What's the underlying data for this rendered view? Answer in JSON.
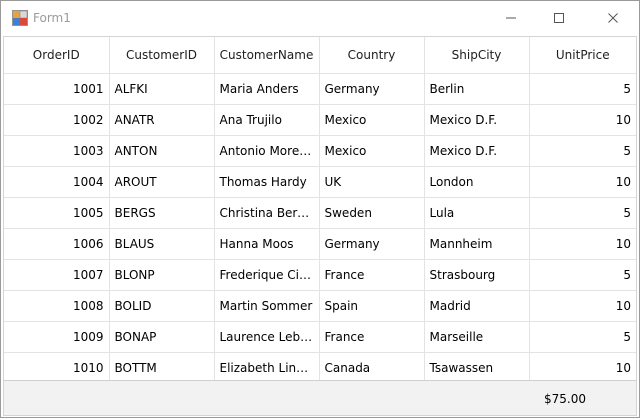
{
  "window": {
    "title": "Form1"
  },
  "grid": {
    "columns": [
      "OrderID",
      "CustomerID",
      "CustomerName",
      "Country",
      "ShipCity",
      "UnitPrice"
    ],
    "rows": [
      [
        "1001",
        "ALFKI",
        "Maria Anders",
        "Germany",
        "Berlin",
        "5"
      ],
      [
        "1002",
        "ANATR",
        "Ana Trujilo",
        "Mexico",
        "Mexico D.F.",
        "10"
      ],
      [
        "1003",
        "ANTON",
        "Antonio Moreno",
        "Mexico",
        "Mexico D.F.",
        "5"
      ],
      [
        "1004",
        "AROUT",
        "Thomas Hardy",
        "UK",
        "London",
        "10"
      ],
      [
        "1005",
        "BERGS",
        "Christina Berglund",
        "Sweden",
        "Lula",
        "5"
      ],
      [
        "1006",
        "BLAUS",
        "Hanna Moos",
        "Germany",
        "Mannheim",
        "10"
      ],
      [
        "1007",
        "BLONP",
        "Frederique Citeaux",
        "France",
        "Strasbourg",
        "5"
      ],
      [
        "1008",
        "BOLID",
        "Martin Sommer",
        "Spain",
        "Madrid",
        "10"
      ],
      [
        "1009",
        "BONAP",
        "Laurence Lebihan",
        "France",
        "Marseille",
        "5"
      ],
      [
        "1010",
        "BOTTM",
        "Elizabeth Lincoln",
        "Canada",
        "Tsawassen",
        "10"
      ]
    ],
    "summary_value": "$75.00"
  }
}
